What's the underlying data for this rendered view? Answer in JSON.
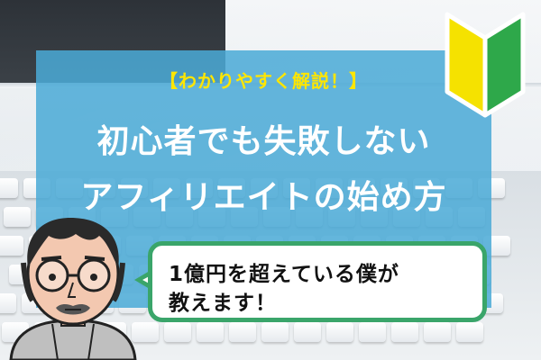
{
  "banner": {
    "subtitle": "【わかりやすく解説！】",
    "title_line1": "初心者でも失敗しない",
    "title_line2": "アフィリエイトの始め方",
    "speech_line1": "1億円を超えている僕が",
    "speech_line2": "教えます！"
  },
  "icons": {
    "badge": "beginner-mark-icon",
    "character": "man-with-glasses-avatar"
  },
  "colors": {
    "panel": "#4aaad6",
    "subtitle": "#ffe600",
    "title": "#ffffff",
    "bubble_border": "#3aa56a",
    "mark_yellow": "#f5e200",
    "mark_green": "#2ea84a"
  }
}
